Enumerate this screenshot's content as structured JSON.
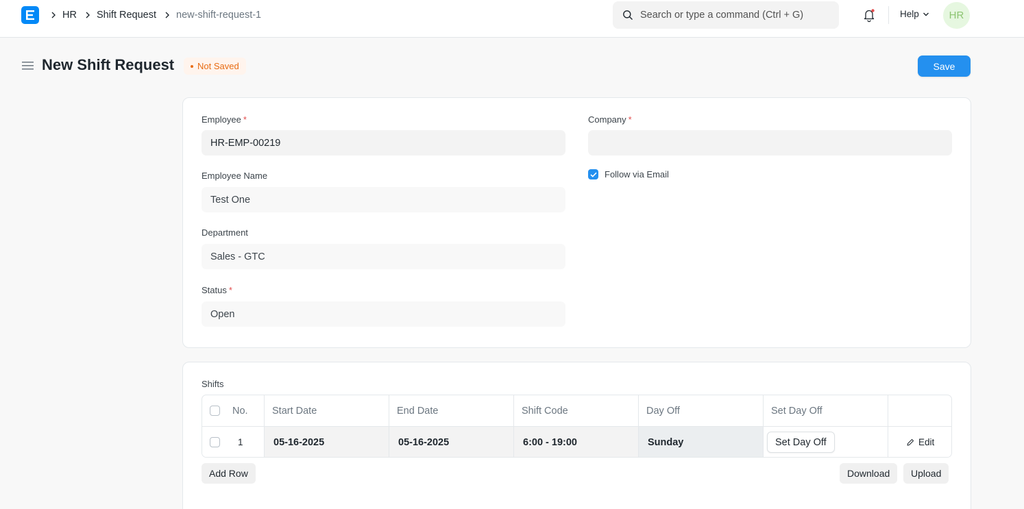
{
  "nav": {
    "breadcrumbs": [
      "HR",
      "Shift Request",
      "new-shift-request-1"
    ],
    "search_placeholder": "Search or type a command (Ctrl + G)",
    "help_label": "Help",
    "avatar_initials": "HR"
  },
  "page": {
    "title": "New Shift Request",
    "indicator": "Not Saved",
    "save_label": "Save"
  },
  "form": {
    "employee": {
      "label": "Employee",
      "value": "HR-EMP-00219"
    },
    "employee_name": {
      "label": "Employee Name",
      "value": "Test One"
    },
    "department": {
      "label": "Department",
      "value": "Sales - GTC"
    },
    "status": {
      "label": "Status",
      "value": "Open"
    },
    "company": {
      "label": "Company",
      "value": ""
    },
    "follow_via_email": {
      "label": "Follow via Email",
      "checked": true
    }
  },
  "shifts": {
    "label": "Shifts",
    "columns": [
      "No.",
      "Start Date",
      "End Date",
      "Shift Code",
      "Day Off",
      "Set Day Off"
    ],
    "rows": [
      {
        "no": "1",
        "start_date": "05-16-2025",
        "end_date": "05-16-2025",
        "shift_code": "6:00 - 19:00",
        "day_off": "Sunday",
        "set_day_off": "Set Day Off",
        "edit": "Edit"
      }
    ],
    "add_row_label": "Add Row",
    "download_label": "Download",
    "upload_label": "Upload"
  },
  "colors": {
    "primary": "#2490ef",
    "brand": "#0289f7",
    "not_saved": "#e86c13",
    "required": "#e24c4c"
  }
}
